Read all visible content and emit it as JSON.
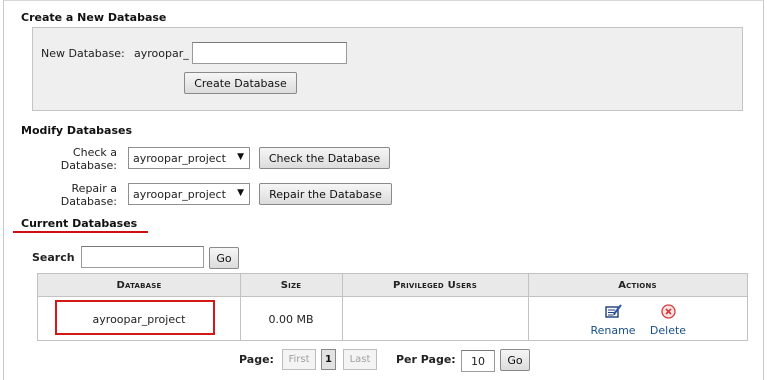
{
  "create": {
    "heading": "Create a New Database",
    "new_db_label": "New Database:",
    "prefix": "ayroopar_",
    "new_db_value": "",
    "create_button": "Create Database"
  },
  "modify": {
    "heading": "Modify Databases",
    "check_label_1": "Check a",
    "check_label_2": "Database:",
    "check_selected": "ayroopar_project",
    "check_button": "Check the Database",
    "repair_label_1": "Repair a",
    "repair_label_2": "Database:",
    "repair_selected": "ayroopar_project",
    "repair_button": "Repair the Database"
  },
  "current": {
    "heading": "Current Databases",
    "search_label": "Search",
    "search_value": "",
    "go_button": "Go",
    "columns": [
      "Database",
      "Size",
      "Privileged Users",
      "Actions"
    ],
    "rows": [
      {
        "database": "ayroopar_project",
        "size": "0.00 MB",
        "users": "",
        "rename": "Rename",
        "delete": "Delete"
      }
    ]
  },
  "pagination": {
    "page_label": "Page:",
    "first": "First",
    "current_page": "1",
    "last": "Last",
    "per_page_label": "Per Page:",
    "per_page_value": "10",
    "go_button": "Go"
  },
  "colors": {
    "highlight": "#d31818",
    "link": "#1a4f86",
    "panel_bg": "#efefef",
    "header_bg": "#e9e9e9"
  },
  "icons": {
    "rename": "rename-edit-icon",
    "delete": "delete-x-circle-icon",
    "dropdown": "triangle-down-icon"
  }
}
